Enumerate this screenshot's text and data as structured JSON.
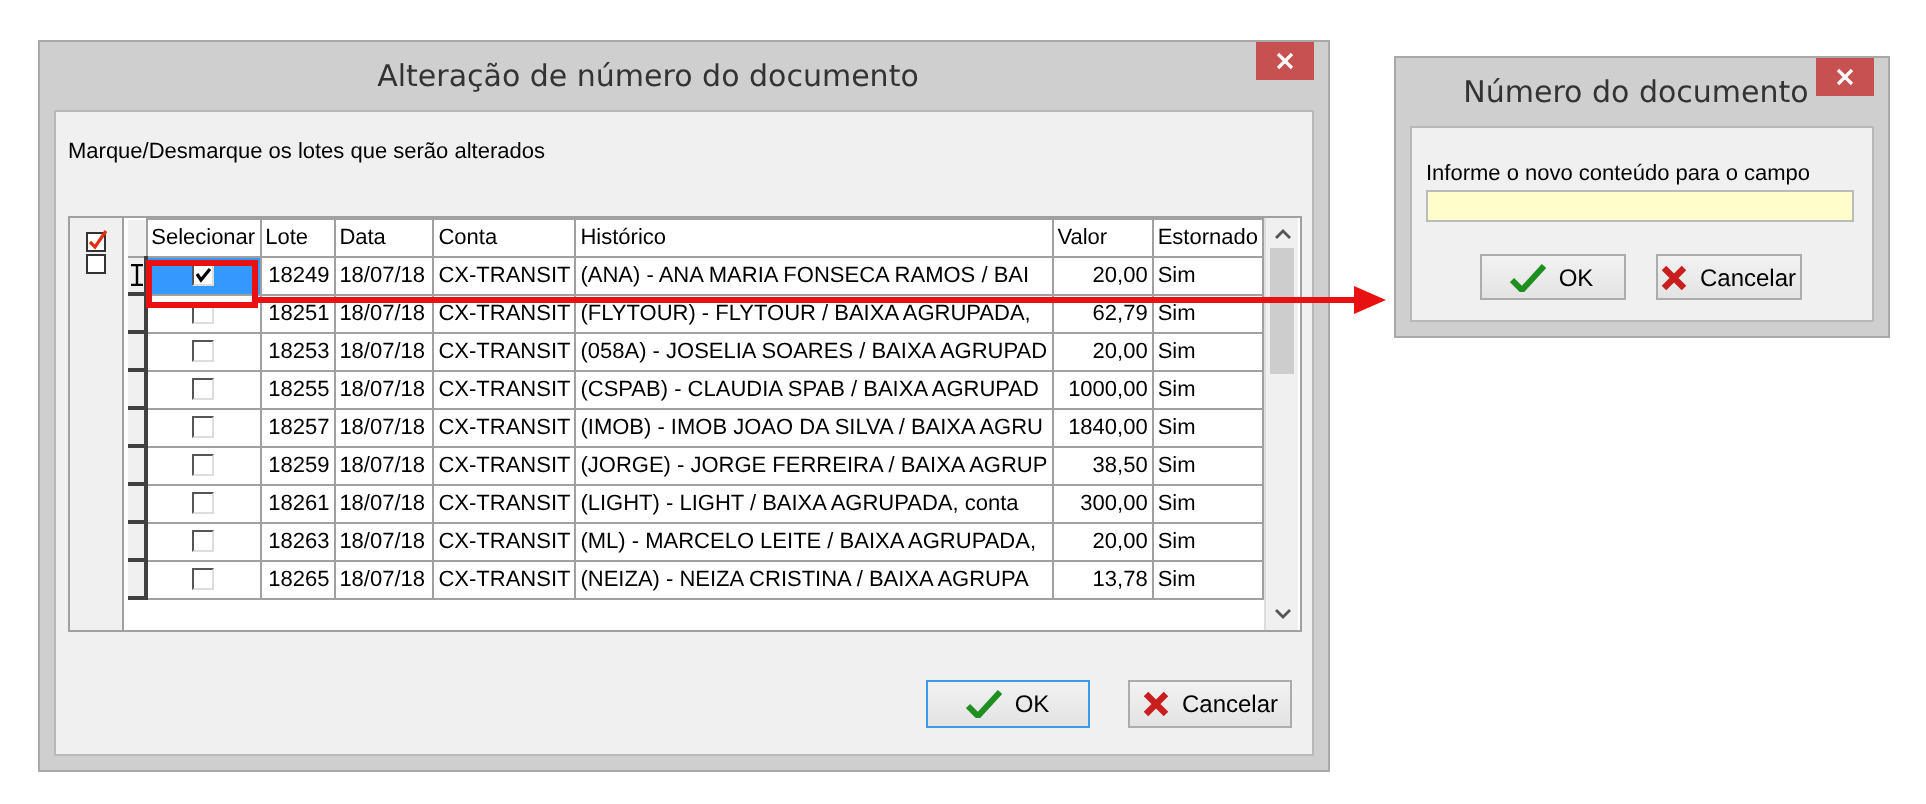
{
  "main_dialog": {
    "title": "Alteração de número do documento",
    "instruction": "Marque/Desmarque os lotes que serão alterados",
    "table": {
      "columns": [
        "Selecionar",
        "Lote",
        "Data",
        "Conta",
        "Histórico",
        "Valor",
        "Estornado"
      ],
      "rows": [
        {
          "selected": true,
          "checked": true,
          "cells": [
            "",
            "18249",
            "18/07/18",
            "CX-TRANSIT",
            "(ANA) - ANA MARIA FONSECA RAMOS / BAI",
            "20,00",
            "Sim"
          ]
        },
        {
          "selected": false,
          "checked": false,
          "cells": [
            "",
            "18251",
            "18/07/18",
            "CX-TRANSIT",
            "(FLYTOUR) - FLYTOUR / BAIXA AGRUPADA,",
            "62,79",
            "Sim"
          ]
        },
        {
          "selected": false,
          "checked": false,
          "cells": [
            "",
            "18253",
            "18/07/18",
            "CX-TRANSIT",
            "(058A) - JOSELIA SOARES / BAIXA AGRUPAD",
            "20,00",
            "Sim"
          ]
        },
        {
          "selected": false,
          "checked": false,
          "cells": [
            "",
            "18255",
            "18/07/18",
            "CX-TRANSIT",
            "(CSPAB) - CLAUDIA SPAB / BAIXA AGRUPAD",
            "1000,00",
            "Sim"
          ]
        },
        {
          "selected": false,
          "checked": false,
          "cells": [
            "",
            "18257",
            "18/07/18",
            "CX-TRANSIT",
            "(IMOB) - IMOB JOAO DA SILVA / BAIXA AGRU",
            "1840,00",
            "Sim"
          ]
        },
        {
          "selected": false,
          "checked": false,
          "cells": [
            "",
            "18259",
            "18/07/18",
            "CX-TRANSIT",
            "(JORGE) - JORGE FERREIRA / BAIXA AGRUP",
            "38,50",
            "Sim"
          ]
        },
        {
          "selected": false,
          "checked": false,
          "cells": [
            "",
            "18261",
            "18/07/18",
            "CX-TRANSIT",
            "(LIGHT) - LIGHT / BAIXA AGRUPADA, conta",
            "300,00",
            "Sim"
          ]
        },
        {
          "selected": false,
          "checked": false,
          "cells": [
            "",
            "18263",
            "18/07/18",
            "CX-TRANSIT",
            "(ML) - MARCELO LEITE / BAIXA AGRUPADA,",
            "20,00",
            "Sim"
          ]
        },
        {
          "selected": false,
          "checked": false,
          "cells": [
            "",
            "18265",
            "18/07/18",
            "CX-TRANSIT",
            "(NEIZA) - NEIZA CRISTINA / BAIXA AGRUPA",
            "13,78",
            "Sim"
          ]
        }
      ]
    },
    "buttons": [
      {
        "kind": "ok",
        "label": "OK",
        "focused": true
      },
      {
        "kind": "cancel",
        "label": "Cancelar",
        "focused": false
      }
    ]
  },
  "document_dialog": {
    "title": "Número do documento",
    "prompt": "Informe o novo conteúdo para o campo",
    "buttons": [
      {
        "kind": "ok",
        "label": "OK",
        "focused": false
      },
      {
        "kind": "cancel",
        "label": "Cancelar",
        "focused": false
      }
    ]
  }
}
